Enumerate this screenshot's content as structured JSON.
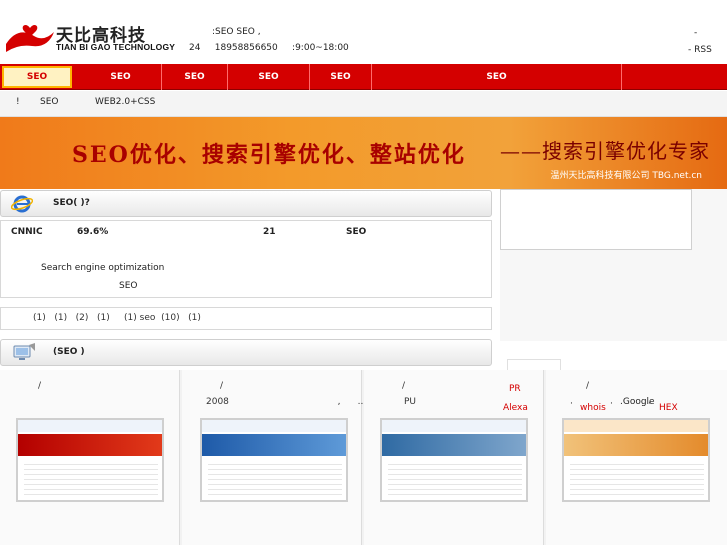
{
  "header": {
    "logo_cn": "天比高科技",
    "logo_en": "TIAN BI GAO TECHNOLOGY",
    "info_line1": ":SEO        SEO ,",
    "info_line2": "24     18958856650     :9:00~18:00",
    "top_dash": "-",
    "rss": "- RSS"
  },
  "nav": {
    "items": [
      {
        "label": "SEO",
        "active": true
      },
      {
        "label": "SEO"
      },
      {
        "label": "SEO"
      },
      {
        "label": "SEO"
      },
      {
        "label": "SEO"
      },
      {
        "label": "SEO"
      }
    ]
  },
  "subbar": {
    "items": [
      "!",
      "SEO",
      "WEB2.0+CSS"
    ]
  },
  "banner": {
    "headline": "SEO优化、搜索引擎优化、整站优化",
    "signature": "——搜索引擎优化专家",
    "company": "温州天比高科技有限公司 TBG.net.cn"
  },
  "seo_panel": {
    "title": "SEO(         )?",
    "cnnic": "CNNIC",
    "percent": "69.6%",
    "number": "21",
    "seo": "SEO",
    "english": "Search engine optimization",
    "seo2": "SEO"
  },
  "links_row": {
    "text": "(1)   (1)   (2)   (1)     (1) seo  (10)   (1)"
  },
  "cases_panel": {
    "title": "(SEO          )"
  },
  "cases": [
    {
      "slash": "/",
      "line2": ""
    },
    {
      "slash": "/",
      "line2": "2008                                      ,      ..."
    },
    {
      "slash": "/",
      "line2": "PU"
    },
    {
      "slash": "/",
      "line2": ""
    }
  ],
  "right_extras": {
    "pr": "PR",
    "alexa": "Alexa",
    "whois": "whois",
    "google": ".Google",
    "hex": "HEX",
    "dot1": "·",
    "dot2": "·",
    "dot3": "·"
  },
  "colors": {
    "nav_red": "#d40000",
    "banner_orange": "#f39a2a",
    "banner_text": "#a80000"
  }
}
